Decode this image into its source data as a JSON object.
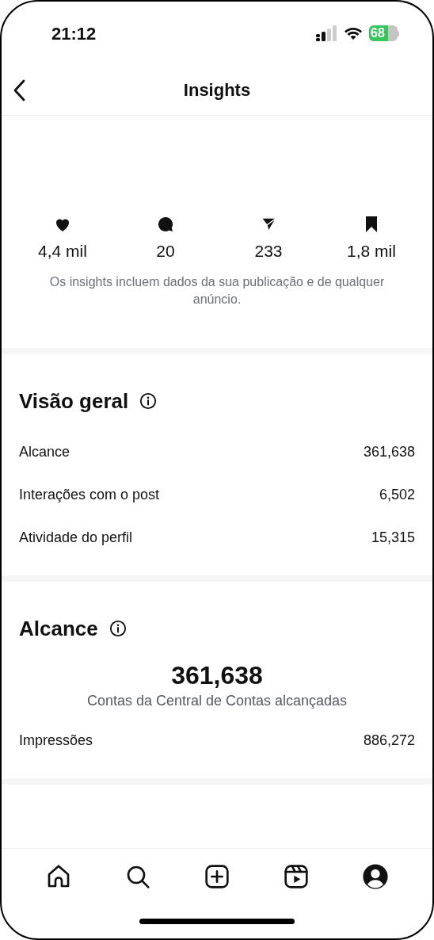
{
  "status_bar": {
    "time": "21:12",
    "battery": "68"
  },
  "header": {
    "title": "Insights"
  },
  "stats": [
    {
      "kind": "likes",
      "value": "4,4 mil"
    },
    {
      "kind": "comments",
      "value": "20"
    },
    {
      "kind": "shares",
      "value": "233"
    },
    {
      "kind": "saves",
      "value": "1,8 mil"
    }
  ],
  "stats_note": "Os insights incluem dados da sua publicação e de qualquer anúncio.",
  "overview": {
    "title": "Visão geral",
    "rows": [
      {
        "label": "Alcance",
        "value": "361,638"
      },
      {
        "label": "Interações com o post",
        "value": "6,502"
      },
      {
        "label": "Atividade do perfil",
        "value": "15,315"
      }
    ]
  },
  "reach": {
    "title": "Alcance",
    "total": "361,638",
    "caption": "Contas da Central de Contas alcançadas",
    "rows": [
      {
        "label": "Impressões",
        "value": "886,272"
      }
    ]
  },
  "nav": [
    {
      "kind": "home"
    },
    {
      "kind": "search"
    },
    {
      "kind": "create"
    },
    {
      "kind": "reels"
    },
    {
      "kind": "profile"
    }
  ]
}
